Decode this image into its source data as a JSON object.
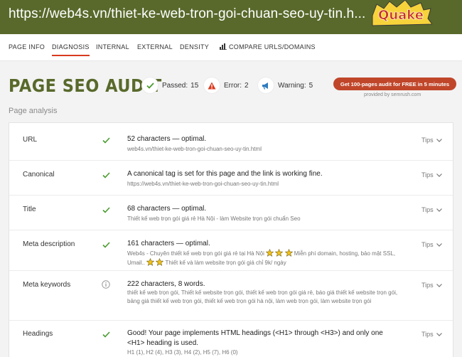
{
  "header": {
    "url": "https://web4s.vn/thiet-ke-web-tron-goi-chuan-seo-uy-tin.h...",
    "logo_text": "Quake"
  },
  "nav": {
    "items": [
      "PAGE INFO",
      "DIAGNOSIS",
      "INTERNAL",
      "EXTERNAL",
      "DENSITY",
      "COMPARE URLS/DOMAINS"
    ]
  },
  "audit": {
    "title": "PAGE SEO AUDIT",
    "passed_label": "Passed:",
    "passed_count": "15",
    "error_label": "Error:",
    "error_count": "2",
    "warning_label": "Warning:",
    "warning_count": "5",
    "cta_label": "Get 100-pages audit for FREE in 5 minutes",
    "provided_by": "provided by semrush.com",
    "colors": {
      "brand": "#58692b",
      "cta": "#c0462a",
      "passed": "#4a9b2f",
      "error": "#d93a1f",
      "warning": "#2f7bbf",
      "active_tab": "#d93a1f"
    }
  },
  "section_label": "Page analysis",
  "tips_label": "Tips",
  "rows": [
    {
      "label": "URL",
      "status_icon": "check-icon",
      "main": "52 characters — optimal.",
      "sub": "web4s.vn/thiet-ke-web-tron-goi-chuan-seo-uy-tin.html"
    },
    {
      "label": "Canonical",
      "status_icon": "check-icon",
      "main": "A canonical tag is set for this page and the link is working fine.",
      "sub": "https://web4s.vn/thiet-ke-web-tron-goi-chuan-seo-uy-tin.html"
    },
    {
      "label": "Title",
      "status_icon": "check-icon",
      "main": "68 characters — optimal.",
      "sub": "Thiết kế web trọn gói giá rẻ Hà Nội - làm Website trọn gói chuẩn Seo"
    },
    {
      "label": "Meta description",
      "status_icon": "check-icon",
      "main": "161 characters — optimal.",
      "sub_parts": [
        "Web4s - Chuyên thiết kế web trọn gói giá rẻ tại Hà Nội",
        " Miễn phí domain, hosting, bảo mật SSL, Umail..",
        " Thiết kế và làm website trọn gói giá chỉ 9k/ ngày"
      ]
    },
    {
      "label": "Meta keywords",
      "status_icon": "info-icon",
      "main": "222 characters, 8 words.",
      "sub": "thiết kế web trọn gói, Thiết kế website trọn gói, thiết kế web trọn gói giá rẻ, báo giá thiết kế website trọn gói, bảng giá thiết kế web trọn gói, thiết kế web trọn gói hà nội, làm web trọn gói, làm website trọn gói"
    },
    {
      "label": "Headings",
      "status_icon": "check-icon",
      "main": "Good! Your page implements HTML headings (<H1> through <H3>) and only one <H1> heading is used.",
      "sub": "H1 (1), H2 (4), H3 (3), H4 (2), H5 (7), H6 (0)"
    }
  ]
}
